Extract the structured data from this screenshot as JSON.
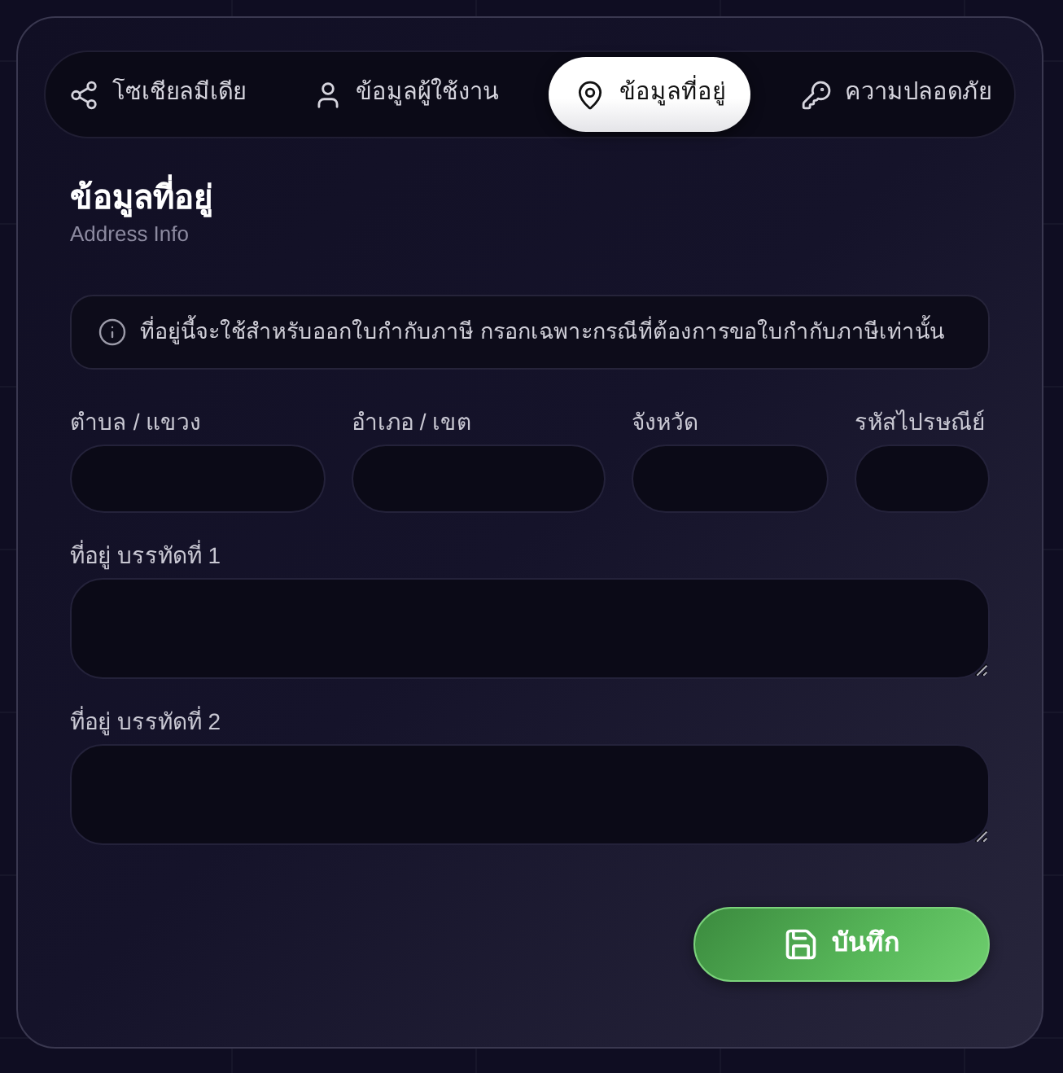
{
  "tabs": [
    {
      "label": "โซเชียลมีเดีย",
      "selected": false
    },
    {
      "label": "ข้อมูลผู้ใช้งาน",
      "selected": false
    },
    {
      "label": "ข้อมูลที่อยู่",
      "selected": true
    },
    {
      "label": "ความปลอดภัย",
      "selected": false
    }
  ],
  "section": {
    "title": "ข้อมูลที่อยู่",
    "subtitle": "Address Info"
  },
  "notice": {
    "text": "ที่อยู่นี้จะใช้สำหรับออกใบกำกับภาษี กรอกเฉพาะกรณีที่ต้องการขอใบกำกับภาษีเท่านั้น"
  },
  "location_fields": [
    {
      "label": "ตำบล / แขวง"
    },
    {
      "label": "อำเภอ / เขต"
    },
    {
      "label": "จังหวัด"
    },
    {
      "label": "รหัสไปรษณีย์"
    }
  ],
  "address_lines": [
    {
      "label": "ที่อยู่ บรรทัดที่ 1"
    },
    {
      "label": "ที่อยู่ บรรทัดที่ 2"
    }
  ],
  "save_button": {
    "label": "บันทึก"
  }
}
